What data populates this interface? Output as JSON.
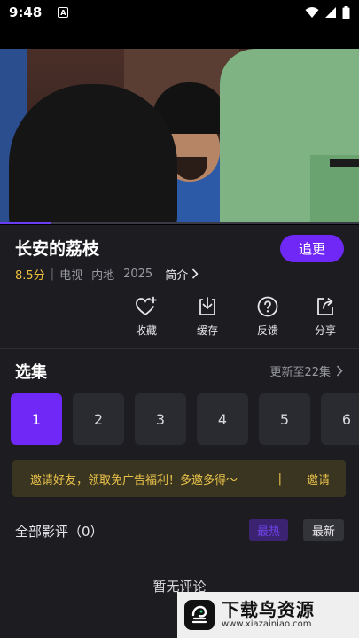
{
  "status_bar": {
    "time": "9:48",
    "notification_letter": "A"
  },
  "video": {
    "progress_fraction": 0.14
  },
  "show": {
    "title": "长安的荔枝",
    "follow_label": "追更",
    "score": "8.5分",
    "separator": "|",
    "type": "电视",
    "region": "内地",
    "year": "2025",
    "intro_label": "简介"
  },
  "actions": [
    {
      "label": "收藏",
      "icon": "heart-plus-icon"
    },
    {
      "label": "缓存",
      "icon": "download-icon"
    },
    {
      "label": "反馈",
      "icon": "help-icon"
    },
    {
      "label": "分享",
      "icon": "share-icon"
    }
  ],
  "episodes": {
    "title": "选集",
    "update_text": "更新至22集",
    "items": [
      "1",
      "2",
      "3",
      "4",
      "5",
      "6"
    ],
    "selected": "1"
  },
  "banner": {
    "text": "邀请好友，领取免广告福利！多邀多得〜",
    "divider": "|",
    "link": "邀请"
  },
  "reviews": {
    "title": "全部影评（0）",
    "sort_hot": "最热",
    "sort_new": "最新",
    "empty_text": "暂无评论"
  },
  "watermark": {
    "name": "下载鸟资源",
    "url": "www.xiazainiao.com"
  },
  "colors": {
    "accent": "#6f28f6",
    "score": "#f0c23b",
    "banner_text": "#e9c24b",
    "background": "#1c1c21"
  }
}
